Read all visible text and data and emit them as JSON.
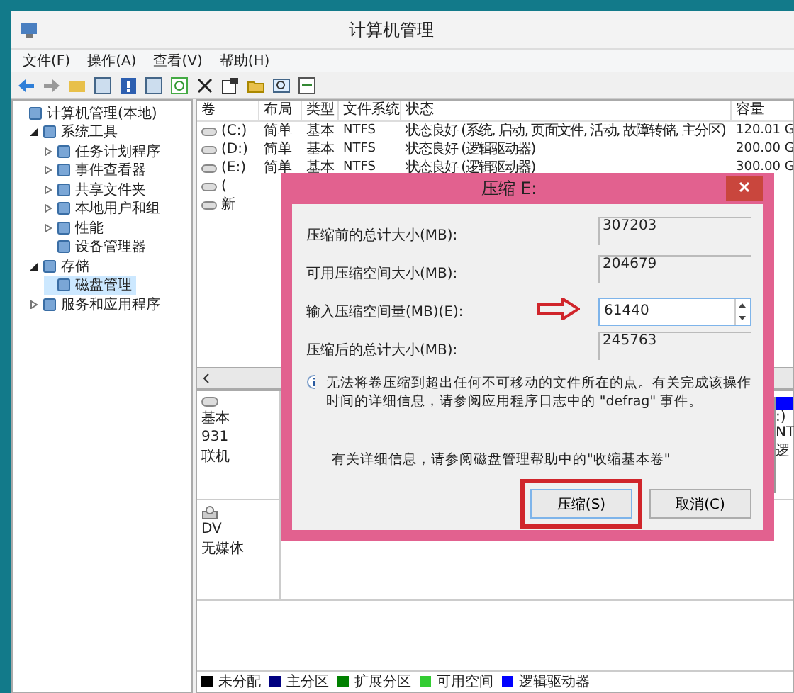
{
  "window": {
    "title": "计算机管理"
  },
  "menu": [
    "文件(F)",
    "操作(A)",
    "查看(V)",
    "帮助(H)"
  ],
  "tree": [
    {
      "label": "计算机管理(本地)",
      "selected": false,
      "children": [
        {
          "label": "系统工具",
          "expandable": true,
          "expanded": true,
          "selected": false,
          "children": [
            {
              "label": "任务计划程序",
              "expandable": true,
              "expanded": false,
              "selected": false
            },
            {
              "label": "事件查看器",
              "expandable": true,
              "expanded": false,
              "selected": false
            },
            {
              "label": "共享文件夹",
              "expandable": true,
              "expanded": false,
              "selected": false
            },
            {
              "label": "本地用户和组",
              "expandable": true,
              "expanded": false,
              "selected": false
            },
            {
              "label": "性能",
              "expandable": true,
              "expanded": false,
              "selected": false
            },
            {
              "label": "设备管理器",
              "expandable": false,
              "expanded": false,
              "selected": false
            }
          ]
        },
        {
          "label": "存储",
          "expandable": true,
          "expanded": true,
          "selected": false,
          "children": [
            {
              "label": "磁盘管理",
              "expandable": false,
              "expanded": false,
              "selected": true
            }
          ]
        },
        {
          "label": "服务和应用程序",
          "expandable": true,
          "expanded": false,
          "selected": false
        }
      ]
    }
  ],
  "volumes": {
    "columns": [
      "卷",
      "布局",
      "类型",
      "文件系统",
      "状态",
      "容量"
    ],
    "rows": [
      [
        "(C:)",
        "简单",
        "基本",
        "NTFS",
        "状态良好 (系统, 启动, 页面文件, 活动, 故障转储, 主分区)",
        "120.01 G"
      ],
      [
        "(D:)",
        "简单",
        "基本",
        "NTFS",
        "状态良好 (逻辑驱动器)",
        "200.00 G"
      ],
      [
        "(E:)",
        "简单",
        "基本",
        "NTFS",
        "状态良好 (逻辑驱动器)",
        "300.00 G"
      ],
      [
        "(",
        "",
        "",
        "",
        "",
        ""
      ],
      [
        "新",
        "",
        "",
        "",
        "",
        ""
      ]
    ]
  },
  "disks": [
    {
      "kind": "disk",
      "lines": [
        "基本",
        "931",
        "联机"
      ]
    },
    {
      "kind": "dvd",
      "lines": [
        "DV",
        "无媒体"
      ]
    }
  ],
  "partition": {
    "lines": [
      ":)",
      "NT",
      "逻"
    ]
  },
  "legend": [
    {
      "label": "未分配",
      "color": "#000000"
    },
    {
      "label": "主分区",
      "color": "#000080"
    },
    {
      "label": "扩展分区",
      "color": "#008000"
    },
    {
      "label": "可用空间",
      "color": "#33cc33"
    },
    {
      "label": "逻辑驱动器",
      "color": "#0000ff"
    }
  ],
  "dialog": {
    "title": "压缩 E:",
    "fields": [
      {
        "label": "压缩前的总计大小(MB):",
        "value": "307203",
        "kind": "readonly"
      },
      {
        "label": "可用压缩空间大小(MB):",
        "value": "204679",
        "kind": "readonly"
      },
      {
        "label": "输入压缩空间量(MB)(E):",
        "value": "61440",
        "kind": "spin"
      },
      {
        "label": "压缩后的总计大小(MB):",
        "value": "245763",
        "kind": "readonly"
      }
    ],
    "info": "无法将卷压缩到超出任何不可移动的文件所在的点。有关完成该操作时间的详细信息，请参阅应用程序日志中的 \"defrag\" 事件。",
    "help": "有关详细信息，请参阅磁盘管理帮助中的\"收缩基本卷\"",
    "buttons": [
      {
        "label": "压缩(S)",
        "highlighted": true
      },
      {
        "label": "取消(C)",
        "highlighted": false
      }
    ]
  }
}
